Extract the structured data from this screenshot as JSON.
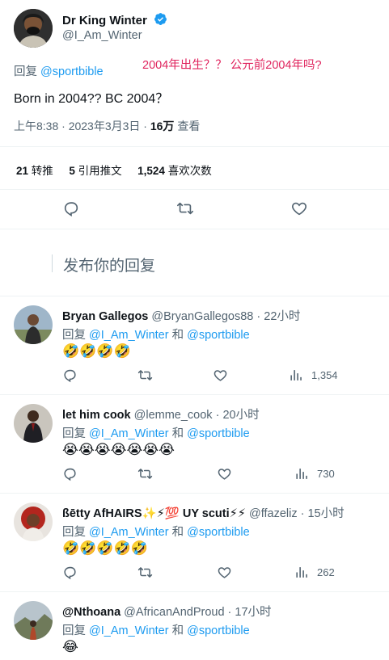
{
  "tweet": {
    "author_name": "Dr King Winter",
    "author_handle": "@I_Am_Winter",
    "reply_prefix": "回复",
    "reply_to": "@sportbible",
    "annotation": "2004年出生？？ 公元前2004年吗?",
    "text": "Born in 2004?? BC 2004？",
    "time": "上午8:38 · 2023年3月3日 · ",
    "views_count": "16万",
    "views_label": " 查看"
  },
  "stats": {
    "retweets_count": "21",
    "retweets_label": "转推",
    "quotes_count": "5",
    "quotes_label": "引用推文",
    "likes_count": "1,524",
    "likes_label": "喜欢次数"
  },
  "compose": {
    "placeholder": "发布你的回复"
  },
  "replies": [
    {
      "name": "Bryan Gallegos",
      "handle": "@BryanGallegos88",
      "time": " · 22小时",
      "reply_prefix": "回复 ",
      "reply_to_1": "@I_Am_Winter",
      "and": " 和 ",
      "reply_to_2": "@sportbible",
      "content": "🤣🤣🤣🤣",
      "views": "1,354"
    },
    {
      "name": "let him cook",
      "handle": "@lemme_cook",
      "time": " · 20小时",
      "reply_prefix": "回复 ",
      "reply_to_1": "@I_Am_Winter",
      "and": " 和 ",
      "reply_to_2": "@sportbible",
      "content": "😭😭😭😭😭😭😭",
      "views": "730"
    },
    {
      "name": "ßētty AfHAIRS✨⚡💯 UY scuti⚡⚡",
      "handle": "@ffazeliz",
      "time": " · 15小时",
      "reply_prefix": "回复 ",
      "reply_to_1": "@I_Am_Winter",
      "and": " 和 ",
      "reply_to_2": "@sportbible",
      "content": "🤣🤣🤣🤣🤣",
      "views": "262"
    },
    {
      "name": "@Nthoana",
      "handle": "@AfricanAndProud",
      "time": " · 17小时",
      "reply_prefix": "回复 ",
      "reply_to_1": "@I_Am_Winter",
      "and": " 和 ",
      "reply_to_2": "@sportbible",
      "content": "😂",
      "views": ""
    }
  ],
  "colors": {
    "accent": "#1d9bf0",
    "annotation_red": "#e0245e",
    "secondary_text": "#536471",
    "divider": "#eff3f4"
  }
}
